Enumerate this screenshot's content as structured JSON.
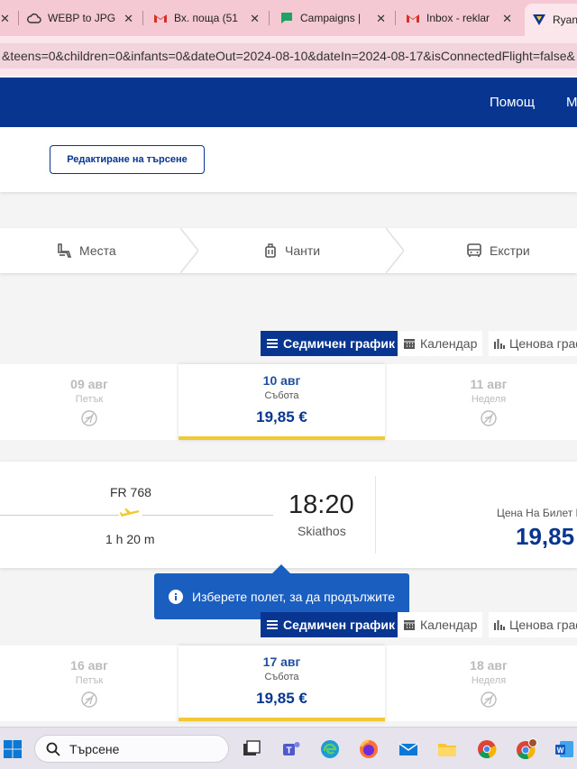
{
  "browser": {
    "tabs": [
      {
        "title": "WEBP to JPG",
        "icon": "cloud-icon"
      },
      {
        "title": "Вх. поща (51",
        "icon": "gmail-icon"
      },
      {
        "title": "Campaigns |",
        "icon": "chat-icon"
      },
      {
        "title": "Inbox - reklar",
        "icon": "gmail-icon"
      },
      {
        "title": "Ryan",
        "icon": "ryanair-icon"
      }
    ],
    "url": "&teens=0&children=0&infants=0&dateOut=2024-08-10&dateIn=2024-08-17&isConnectedFlight=false&"
  },
  "header": {
    "help": "Помощ",
    "more": "М"
  },
  "search": {
    "edit_label": "Редактиране на търсене"
  },
  "steps": [
    {
      "label": "Места",
      "icon": "seat-icon"
    },
    {
      "label": "Чанти",
      "icon": "luggage-icon"
    },
    {
      "label": "Екстри",
      "icon": "bus-icon"
    }
  ],
  "views": {
    "weekly": "Седмичен график",
    "calendar": "Календар",
    "price": "Ценова граф"
  },
  "outbound": {
    "dates": [
      {
        "date": "09 авг",
        "weekday": "Петък",
        "available": false
      },
      {
        "date": "10 авг",
        "weekday": "Събота",
        "price": "19,85 €",
        "selected": true
      },
      {
        "date": "11 авг",
        "weekday": "Неделя",
        "available": false
      }
    ]
  },
  "flight": {
    "number": "FR 768",
    "duration": "1 h 20 m",
    "arrival_time": "18:20",
    "arrival_city": "Skiathos",
    "price_label": "Цена На Билет Е",
    "price": "19,85"
  },
  "tooltip": {
    "text": "Изберете полет, за да продължите"
  },
  "inbound": {
    "dates": [
      {
        "date": "16 авг",
        "weekday": "Петък",
        "available": false
      },
      {
        "date": "17 авг",
        "weekday": "Събота",
        "price": "19,85 €",
        "selected": true
      },
      {
        "date": "18 авг",
        "weekday": "Неделя",
        "available": false
      }
    ]
  },
  "taskbar": {
    "search": "Търсене"
  },
  "colors": {
    "brand_blue": "#073590",
    "accent_yellow": "#f1c933",
    "tab_pink": "#f5c9d3"
  }
}
